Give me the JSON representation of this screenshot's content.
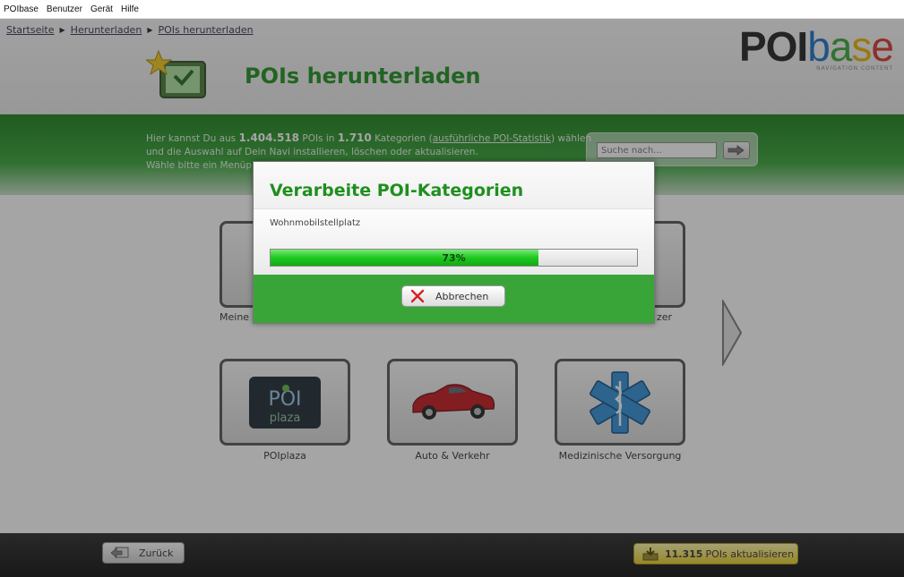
{
  "menubar": {
    "items": [
      "POIbase",
      "Benutzer",
      "Gerät",
      "Hilfe"
    ]
  },
  "breadcrumb": [
    "Startseite",
    "Herunterladen",
    "POIs herunterladen"
  ],
  "logo": {
    "poi": "POI",
    "b": "b",
    "a": "a",
    "s": "s",
    "e": "e",
    "tagline": "NAVIGATION CONTENT"
  },
  "page": {
    "title": "POIs herunterladen"
  },
  "intro": {
    "t1": "Hier kannst Du aus ",
    "pois": "1.404.518",
    "t2": " POIs in ",
    "cats": "1.710",
    "t3": " Kategorien (",
    "link": "ausführliche POI-Statistik",
    "t4": ") wählen",
    "line2": "und die Auswahl auf Dein Navi installieren, löschen oder aktualisieren.",
    "line3": "Wähle bitte ein Menüp"
  },
  "search": {
    "placeholder": "Suche nach..."
  },
  "tiles": {
    "row1_left_label": "Meine",
    "row1_right_label": "zer",
    "poiplaza": {
      "label": "POIplaza",
      "logo_top": "POI",
      "logo_bottom": "plaza"
    },
    "auto": {
      "label": "Auto & Verkehr"
    },
    "med": {
      "label": "Medizinische Versorgung"
    }
  },
  "footer": {
    "back_label": "Zurück",
    "update_count": "11.315",
    "update_label": "POIs aktualisieren"
  },
  "dialog": {
    "title": "Verarbeite POI-Kategorien",
    "current_item": "Wohnmobilstellplatz",
    "progress_percent": 73,
    "progress_text": "73%",
    "cancel_label": "Abbrechen"
  },
  "colors": {
    "accent_green": "#1f8f1f",
    "progress_green": "#1ec91e",
    "footer_bg": "#1a1a1a",
    "update_button": "#e8cc26"
  }
}
